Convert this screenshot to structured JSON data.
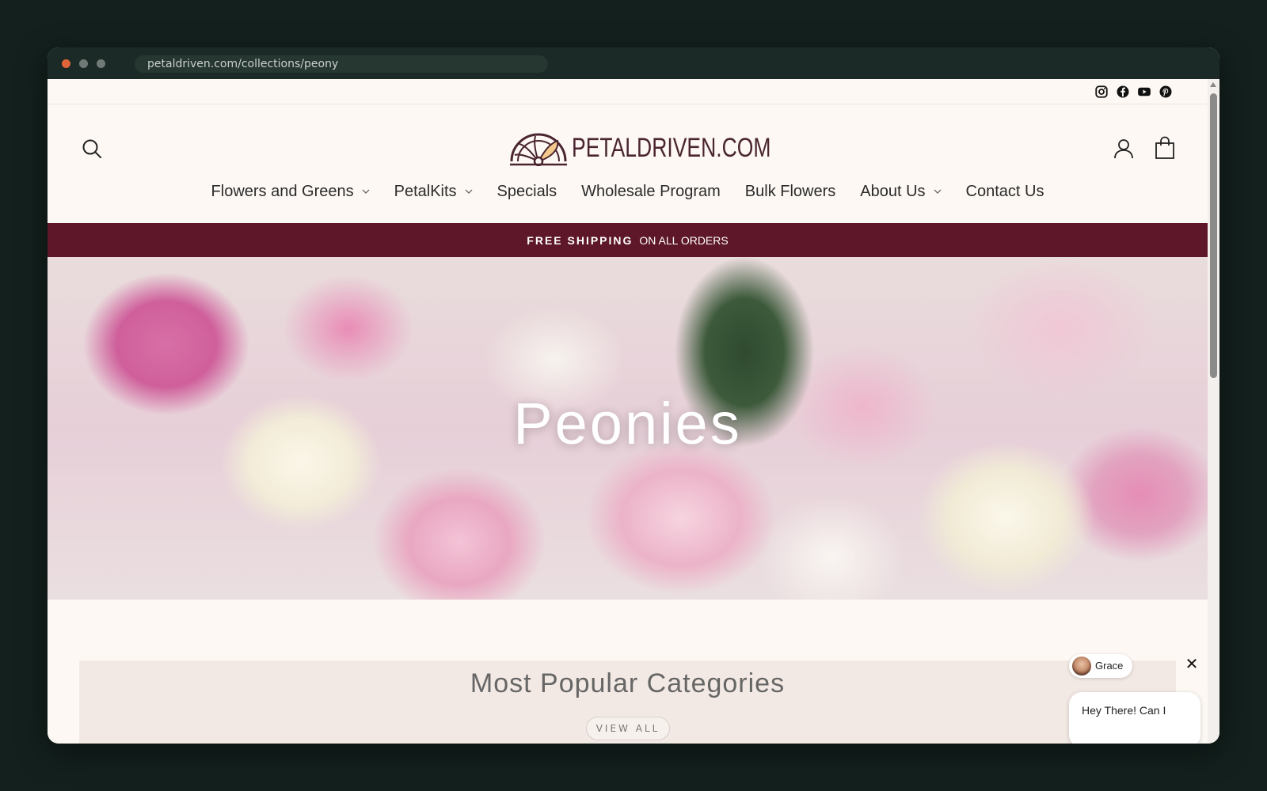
{
  "browser": {
    "url": "petaldriven.com/collections/peony"
  },
  "social": {
    "items": [
      {
        "name": "instagram-icon"
      },
      {
        "name": "facebook-icon"
      },
      {
        "name": "youtube-icon"
      },
      {
        "name": "pinterest-icon"
      }
    ]
  },
  "header": {
    "logo_text": "PETALDRIVEN.COM"
  },
  "nav": {
    "items": [
      {
        "label": "Flowers and Greens",
        "has_dropdown": true
      },
      {
        "label": "PetalKits",
        "has_dropdown": true
      },
      {
        "label": "Specials",
        "has_dropdown": false
      },
      {
        "label": "Wholesale Program",
        "has_dropdown": false
      },
      {
        "label": "Bulk Flowers",
        "has_dropdown": false
      },
      {
        "label": "About Us",
        "has_dropdown": true
      },
      {
        "label": "Contact Us",
        "has_dropdown": false
      }
    ]
  },
  "announcement": {
    "strong": "FREE SHIPPING",
    "rest": "ON ALL ORDERS"
  },
  "hero": {
    "title": "Peonies"
  },
  "categories": {
    "title": "Most Popular Categories",
    "view_all": "VIEW ALL"
  },
  "chat": {
    "agent_name": "Grace",
    "close": "✕",
    "message": "Hey There! Can I"
  },
  "colors": {
    "announcement_bg": "#5e1728",
    "logo": "#4a2530",
    "page_bg": "#fdf8f3"
  }
}
